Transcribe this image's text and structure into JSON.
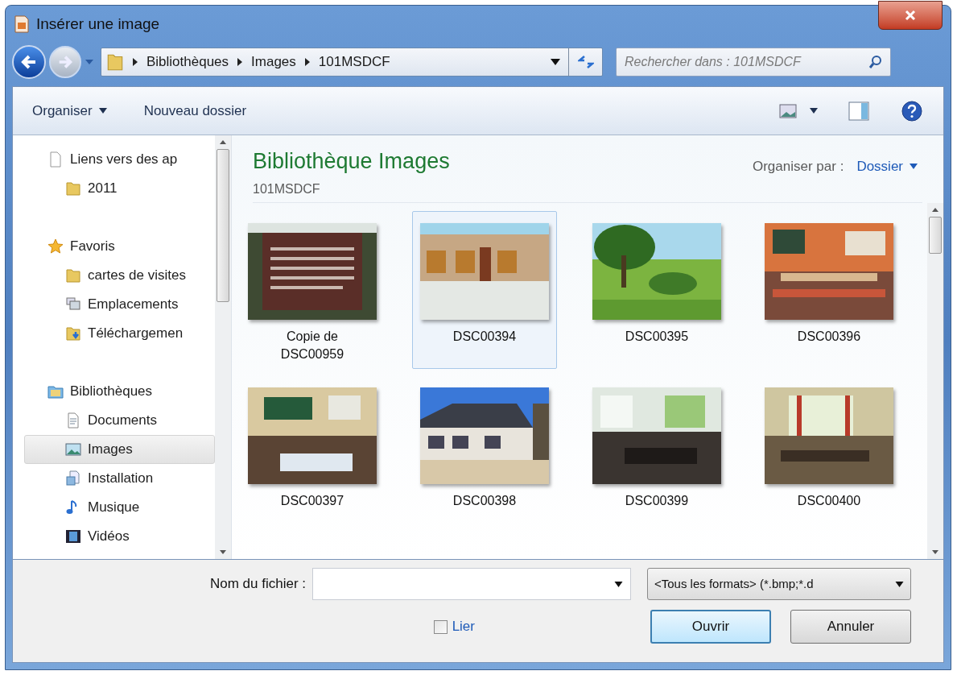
{
  "window": {
    "title": "Insérer une image"
  },
  "address": {
    "crumbs": [
      "Bibliothèques",
      "Images",
      "101MSDCF"
    ]
  },
  "search": {
    "placeholder": "Rechercher dans : 101MSDCF"
  },
  "toolbar": {
    "buttons": [
      "Organiser",
      "Nouveau dossier"
    ]
  },
  "nav": {
    "items": [
      {
        "label": "Liens vers des ap",
        "kind": "file",
        "selected": false,
        "children": [
          {
            "label": "2011",
            "kind": "folder",
            "selected": false
          }
        ]
      },
      {
        "label": "Favoris",
        "kind": "star",
        "selected": false,
        "children": [
          {
            "label": "cartes de visites",
            "kind": "folder",
            "selected": false
          },
          {
            "label": "Emplacements",
            "kind": "places",
            "selected": false
          },
          {
            "label": "Téléchargemen",
            "kind": "download",
            "selected": false
          }
        ]
      },
      {
        "label": "Bibliothèques",
        "kind": "library",
        "selected": false,
        "children": [
          {
            "label": "Documents",
            "kind": "document",
            "selected": false
          },
          {
            "label": "Images",
            "kind": "images",
            "selected": true
          },
          {
            "label": "Installation",
            "kind": "install",
            "selected": false
          },
          {
            "label": "Musique",
            "kind": "music",
            "selected": false
          },
          {
            "label": "Vidéos",
            "kind": "video",
            "selected": false
          }
        ]
      }
    ]
  },
  "content": {
    "title": "Bibliothèque Images",
    "subtitle": "101MSDCF",
    "arrange_label": "Organiser par :",
    "arrange_value": "Dossier",
    "items": [
      {
        "label": "Copie de DSC00959",
        "selected": false
      },
      {
        "label": "DSC00394",
        "selected": true
      },
      {
        "label": "DSC00395",
        "selected": false
      },
      {
        "label": "DSC00396",
        "selected": false
      },
      {
        "label": "DSC00397",
        "selected": false
      },
      {
        "label": "DSC00398",
        "selected": false
      },
      {
        "label": "DSC00399",
        "selected": false
      },
      {
        "label": "DSC00400",
        "selected": false
      }
    ]
  },
  "footer": {
    "filename_label": "Nom du fichier :",
    "filter": "<Tous les formats> (*.bmp;*.d",
    "link_checkbox": {
      "label": "Lier",
      "checked": false
    },
    "buttons": [
      {
        "label": "Ouvrir",
        "default": true
      },
      {
        "label": "Annuler",
        "default": false
      }
    ]
  }
}
